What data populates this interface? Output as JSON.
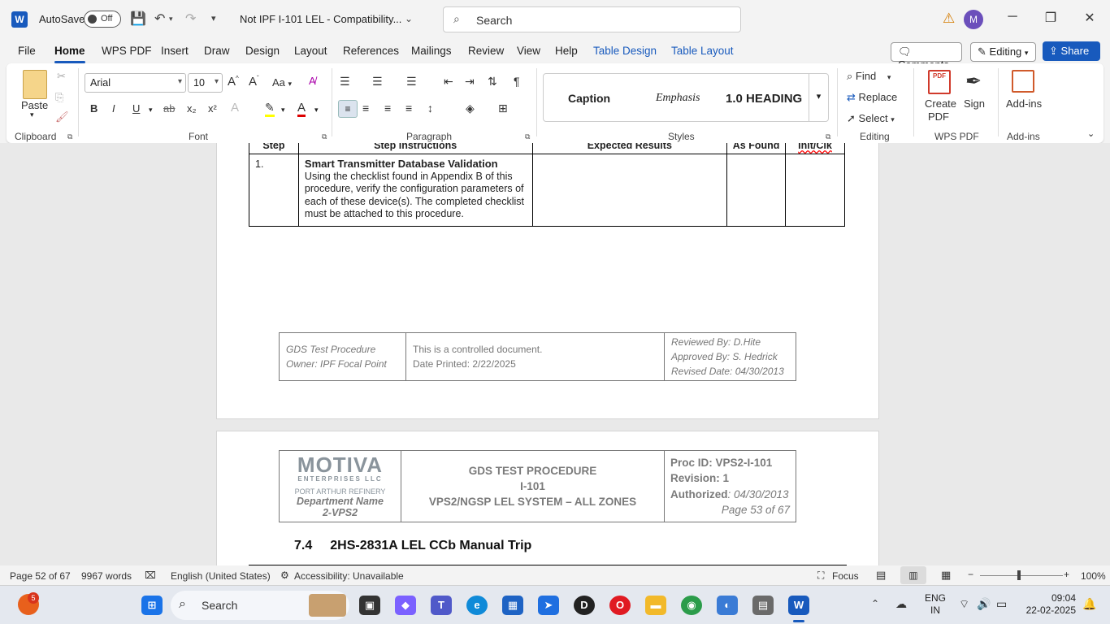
{
  "titlebar": {
    "app_icon": "W",
    "autosave_label": "AutoSave",
    "toggle_state": "Off",
    "doc_title": "Not IPF I-101 LEL  -  Compatibility...",
    "search_placeholder": "Search",
    "avatar_initial": "M"
  },
  "tabs": [
    "File",
    "Home",
    "WPS PDF",
    "Insert",
    "Draw",
    "Design",
    "Layout",
    "References",
    "Mailings",
    "Review",
    "View",
    "Help",
    "Table Design",
    "Table Layout"
  ],
  "actions": {
    "comments": "Comments",
    "editing": "Editing",
    "share": "Share"
  },
  "ribbon": {
    "clipboard": {
      "paste": "Paste",
      "group": "Clipboard"
    },
    "font": {
      "name": "Arial",
      "size": "10",
      "bold": "B",
      "italic": "I",
      "underline": "U",
      "strike": "ab",
      "sub": "x₂",
      "sup": "x²",
      "group": "Font",
      "case": "Aa"
    },
    "paragraph": {
      "group": "Paragraph"
    },
    "styles": {
      "items": [
        "Caption",
        "Emphasis",
        "1.0  HEADING"
      ],
      "group": "Styles"
    },
    "editing": {
      "find": "Find",
      "replace": "Replace",
      "select": "Select",
      "group": "Editing"
    },
    "wpspdf": {
      "create": "Create",
      "create2": "PDF",
      "sign": "Sign",
      "group": "WPS PDF"
    },
    "addins": {
      "label": "Add-ins",
      "group": "Add-ins"
    }
  },
  "document": {
    "table_headers": [
      "Step",
      "Step Instructions",
      "Expected Results",
      "As Found",
      "Init/Clk"
    ],
    "row1": {
      "step": "1.",
      "title": "Smart Transmitter Database Validation",
      "body": "Using the checklist found in Appendix B of this procedure, verify the configuration parameters of each of these device(s). The completed checklist must be attached to this procedure."
    },
    "footer": {
      "left1": "GDS Test Procedure",
      "left2": "Owner: IPF Focal Point",
      "mid1": "This is a controlled document.",
      "mid2": "Date Printed: 2/22/2025",
      "right1": "Reviewed By: D.Hite",
      "right2": "Approved By: S. Hedrick",
      "right3": "Revised Date: 04/30/2013"
    },
    "header": {
      "logo": "MOTIVA",
      "logo_sub": "ENTERPRISES LLC",
      "refinery": "PORT ARTHUR REFINERY",
      "dept1": "Department Name",
      "dept2": "2-VPS2",
      "c1": "GDS TEST PROCEDURE",
      "c2": "I-101",
      "c3": "VPS2/NGSP LEL SYSTEM – ALL ZONES",
      "proc": "Proc ID: VPS2-I-101",
      "rev": "Revision: 1",
      "auth_label": "Authorized",
      "auth_val": ": 04/30/2013",
      "page": "Page 53 of 67"
    },
    "section": {
      "num": "7.4",
      "title": "2HS-2831A LEL CCb Manual Trip"
    }
  },
  "status": {
    "page": "Page 52 of 67",
    "words": "9967 words",
    "lang": "English (United States)",
    "access": "Accessibility: Unavailable",
    "focus": "Focus",
    "zoom": "100%"
  },
  "taskbar": {
    "search": "Search",
    "badge": "5",
    "lang1": "ENG",
    "lang2": "IN",
    "time": "09:04",
    "date": "22-02-2025"
  }
}
